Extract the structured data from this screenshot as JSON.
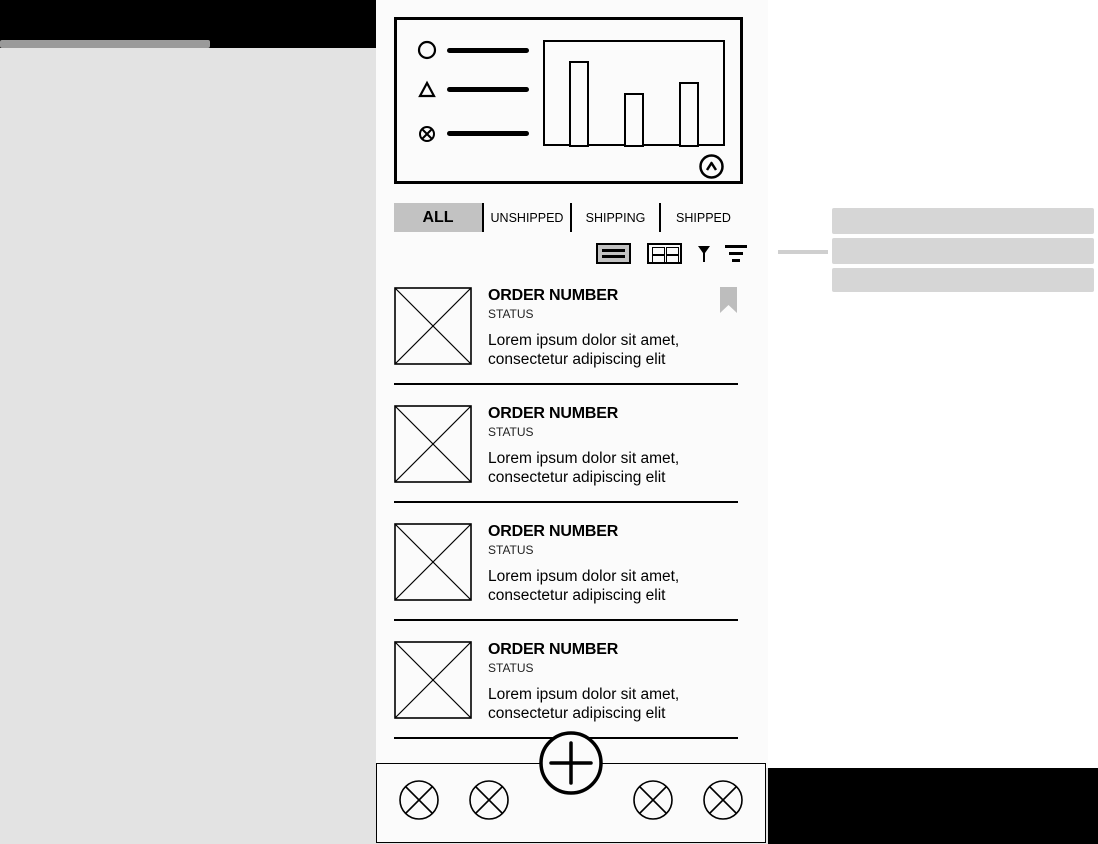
{
  "tabs": [
    {
      "label": "ALL",
      "active": true
    },
    {
      "label": "UNSHIPPED",
      "active": false
    },
    {
      "label": "SHIPPING",
      "active": false
    },
    {
      "label": "SHIPPED",
      "active": false
    }
  ],
  "orders": [
    {
      "title": "ORDER NUMBER",
      "status": "STATUS",
      "desc": "Lorem ipsum dolor sit amet, consectetur adipiscing elit",
      "bookmarked": true
    },
    {
      "title": "ORDER NUMBER",
      "status": "STATUS",
      "desc": "Lorem ipsum dolor sit amet, consectetur adipiscing elit",
      "bookmarked": false
    },
    {
      "title": "ORDER NUMBER",
      "status": "STATUS",
      "desc": "Lorem ipsum dolor sit amet, consectetur adipiscing elit",
      "bookmarked": false
    },
    {
      "title": "ORDER NUMBER",
      "status": "STATUS",
      "desc": "Lorem ipsum dolor sit amet, consectetur adipiscing elit",
      "bookmarked": false
    }
  ],
  "icons": {
    "legend": [
      "circle-icon",
      "triangle-icon",
      "circle-x-icon"
    ],
    "collapse": "chevron-up-icon",
    "view_list": "list-view-icon",
    "view_grid": "grid-view-icon",
    "filter": "filter-icon",
    "sort": "sort-icon",
    "bookmark": "bookmark-icon",
    "fab": "add-icon",
    "nav": [
      "nav-1-icon",
      "nav-2-icon",
      "nav-3-icon",
      "nav-4-icon"
    ]
  },
  "colors": {
    "ink": "#000000",
    "tab_active_bg": "#c2c2c2",
    "canvas_bg": "#e3e3e3",
    "screen_bg": "#fbfbfb",
    "bookmark": "#bdbdbd"
  }
}
